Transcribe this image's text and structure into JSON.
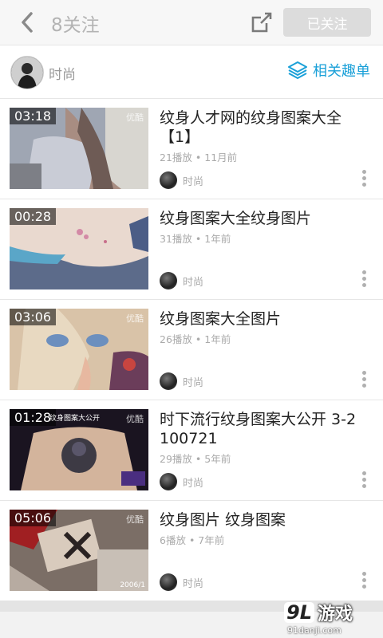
{
  "header": {
    "title": "8关注",
    "follow_label": "已关注"
  },
  "channel": {
    "name": "时尚",
    "related_label": "相关趣单"
  },
  "videos": [
    {
      "duration": "03:18",
      "title": "纹身人才网的纹身图案大全【1】",
      "plays": "21播放",
      "time": "11月前",
      "author": "时尚",
      "watermark": "优酷"
    },
    {
      "duration": "00:28",
      "title": "纹身图案大全纹身图片",
      "plays": "31播放",
      "time": "1年前",
      "author": "时尚",
      "watermark": ""
    },
    {
      "duration": "03:06",
      "title": "纹身图案大全图片",
      "plays": "26播放",
      "time": "1年前",
      "author": "时尚",
      "watermark": "优酷"
    },
    {
      "duration": "01:28",
      "title": "时下流行纹身图案大公开 3-2100721",
      "plays": "29播放",
      "time": "5年前",
      "author": "时尚",
      "watermark": "优酷",
      "thumb_caption": "纹身图案大公开"
    },
    {
      "duration": "05:06",
      "title": "纹身图片 纹身图案",
      "plays": "6播放",
      "time": "7年前",
      "author": "时尚",
      "watermark": "优酷",
      "thumb_caption": "2006/1"
    }
  ],
  "meta_separator": "•",
  "watermark_logo": {
    "number": "9L",
    "name": "游戏",
    "url": "91danji.com"
  },
  "colors": {
    "accent": "#1aa0d8",
    "follow_button_bg": "#dcdcdc"
  }
}
